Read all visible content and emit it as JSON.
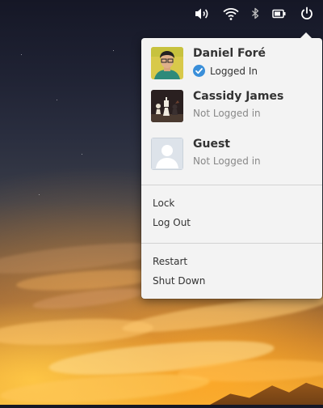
{
  "panel": {
    "indicators": [
      {
        "name": "volume-icon"
      },
      {
        "name": "wifi-icon"
      },
      {
        "name": "bluetooth-icon"
      },
      {
        "name": "battery-icon"
      },
      {
        "name": "power-icon"
      }
    ]
  },
  "session_menu": {
    "users": [
      {
        "name": "Daniel Foré",
        "status": "Logged In",
        "logged_in": true
      },
      {
        "name": "Cassidy James",
        "status": "Not Logged in",
        "logged_in": false
      },
      {
        "name": "Guest",
        "status": "Not Logged in",
        "logged_in": false
      }
    ],
    "actions": {
      "lock": "Lock",
      "log_out": "Log Out",
      "restart": "Restart",
      "shut_down": "Shut Down"
    }
  },
  "colors": {
    "menu_bg": "#f3f3f3",
    "check_accent": "#3a8fd9"
  }
}
